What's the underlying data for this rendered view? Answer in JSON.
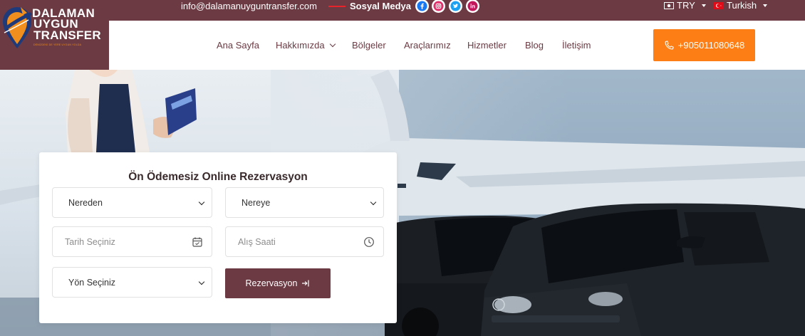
{
  "topbar": {
    "email": "info@dalamanuyguntransfer.com",
    "social_label": "Sosyal Medya",
    "social_icons": [
      "facebook-icon",
      "instagram-icon",
      "twitter-icon",
      "linkedin-icon"
    ],
    "currency": "TRY",
    "language": "Turkish"
  },
  "logo": {
    "line1": "DALAMAN",
    "line2": "UYGUN",
    "line3": "TRANSFER",
    "tagline": "DENİZDEKİ DE YERE UYGUN YOLDA"
  },
  "nav": {
    "items": [
      "Ana Sayfa",
      "Hakkımızda",
      "Bölgeler",
      "Araçlarımız",
      "Hizmetler",
      "Blog",
      "İletişim"
    ],
    "phone": "+905011080648"
  },
  "booking": {
    "title": "Ön Ödemesiz Online Rezervasyon",
    "from": "Nereden",
    "to": "Nereye",
    "date_placeholder": "Tarih Seçiniz",
    "time_placeholder": "Alış Saati",
    "direction": "Yön Seçiniz",
    "submit": "Rezervasyon"
  },
  "colors": {
    "brand": "#6b3a43",
    "accent": "#fd7e14",
    "social_red": "#e8242a"
  }
}
